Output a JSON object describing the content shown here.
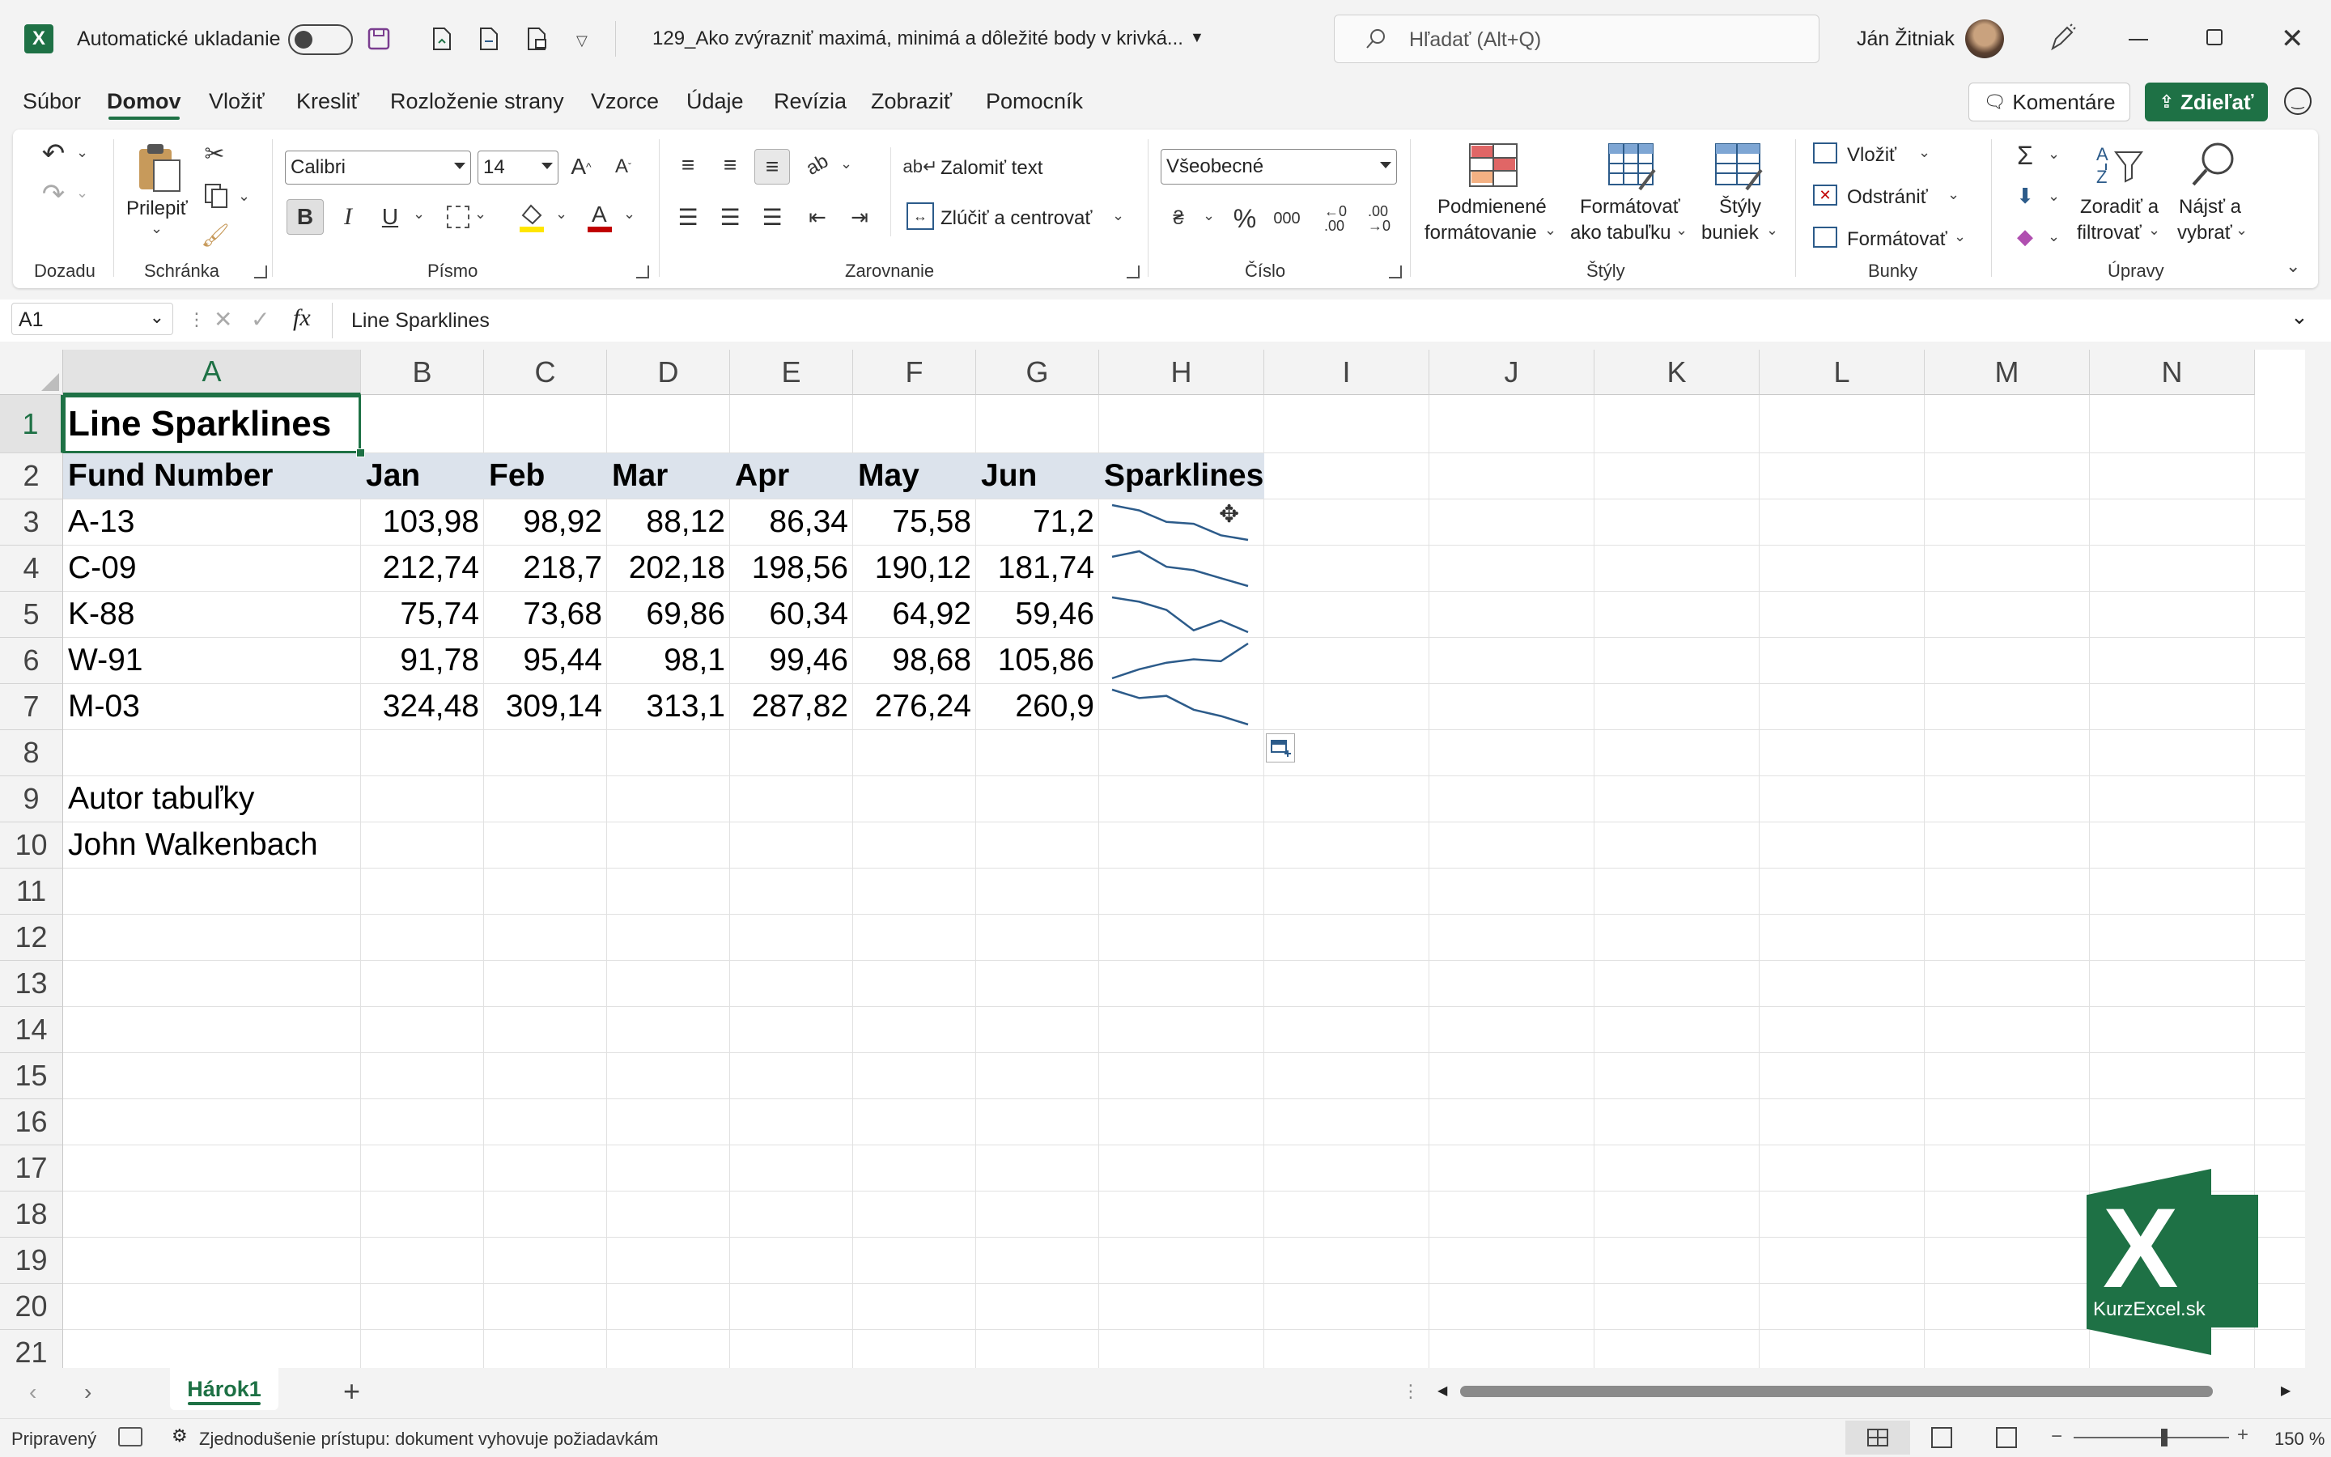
{
  "titlebar": {
    "autosave_label": "Automatické ukladanie",
    "file_name": "129_Ako zvýrazniť maximá, minimá a dôležité body v krivká...",
    "search_placeholder": "Hľadať (Alt+Q)",
    "user_name": "Ján Žitniak"
  },
  "menu": {
    "items": [
      "Súbor",
      "Domov",
      "Vložiť",
      "Kresliť",
      "Rozloženie strany",
      "Vzorce",
      "Údaje",
      "Revízia",
      "Zobraziť",
      "Pomocník"
    ],
    "active": "Domov",
    "comments_label": "Komentáre",
    "share_label": "Zdieľať"
  },
  "ribbon": {
    "groups": {
      "undo": "Dozadu",
      "clipboard": "Schránka",
      "font": "Písmo",
      "alignment": "Zarovnanie",
      "number": "Číslo",
      "styles": "Štýly",
      "cells": "Bunky",
      "editing": "Úpravy"
    },
    "paste_label": "Prilepiť",
    "font_name": "Calibri",
    "font_size": "14",
    "wrap_text": "Zalomiť text",
    "merge_center": "Zlúčiť a centrovať",
    "number_format": "Všeobecné",
    "conditional_1": "Podmienené",
    "conditional_2": "formátovanie",
    "format_table_1": "Formátovať",
    "format_table_2": "ako tabuľku",
    "cell_styles_1": "Štýly",
    "cell_styles_2": "buniek",
    "insert": "Vložiť",
    "delete": "Odstrániť",
    "format": "Formátovať",
    "sort_1": "Zoradiť a",
    "sort_2": "filtrovať",
    "find_1": "Nájsť a",
    "find_2": "vybrať"
  },
  "formula": {
    "name_box": "A1",
    "content": "Line Sparklines"
  },
  "columns": [
    "A",
    "B",
    "C",
    "D",
    "E",
    "F",
    "G",
    "H",
    "I",
    "J",
    "K",
    "L",
    "M",
    "N"
  ],
  "rows": [
    "1",
    "2",
    "3",
    "4",
    "5",
    "6",
    "7",
    "8",
    "9",
    "10",
    "11",
    "12",
    "13",
    "14",
    "15",
    "16",
    "17",
    "18",
    "19",
    "20",
    "21"
  ],
  "sheet": {
    "title": "Line Sparklines",
    "headers": [
      "Fund Number",
      "Jan",
      "Feb",
      "Mar",
      "Apr",
      "May",
      "Jun",
      "Sparklines"
    ],
    "funds": [
      {
        "name": "A-13",
        "values": [
          "103,98",
          "98,92",
          "88,12",
          "86,34",
          "75,58",
          "71,2"
        ],
        "series": [
          103.98,
          98.92,
          88.12,
          86.34,
          75.58,
          71.2
        ]
      },
      {
        "name": "C-09",
        "values": [
          "212,74",
          "218,7",
          "202,18",
          "198,56",
          "190,12",
          "181,74"
        ],
        "series": [
          212.74,
          218.7,
          202.18,
          198.56,
          190.12,
          181.74
        ]
      },
      {
        "name": "K-88",
        "values": [
          "75,74",
          "73,68",
          "69,86",
          "60,34",
          "64,92",
          "59,46"
        ],
        "series": [
          75.74,
          73.68,
          69.86,
          60.34,
          64.92,
          59.46
        ]
      },
      {
        "name": "W-91",
        "values": [
          "91,78",
          "95,44",
          "98,1",
          "99,46",
          "98,68",
          "105,86"
        ],
        "series": [
          91.78,
          95.44,
          98.1,
          99.46,
          98.68,
          105.86
        ]
      },
      {
        "name": "M-03",
        "values": [
          "324,48",
          "309,14",
          "313,1",
          "287,82",
          "276,24",
          "260,9"
        ],
        "series": [
          324.48,
          309.14,
          313.1,
          287.82,
          276.24,
          260.9
        ]
      }
    ],
    "author_label": "Autor tabuľky",
    "author_name": "John Walkenbach"
  },
  "tabs": {
    "sheet_name": "Hárok1"
  },
  "status": {
    "ready": "Pripravený",
    "accessibility": "Zjednodušenie prístupu: dokument vyhovuje požiadavkám",
    "zoom": "150 %"
  },
  "logo": {
    "letter": "X",
    "text": "KurzExcel.sk"
  },
  "colors": {
    "excel_green": "#1e7145",
    "sparkline": "#2c5b8a",
    "header_fill": "#dce3ec"
  }
}
